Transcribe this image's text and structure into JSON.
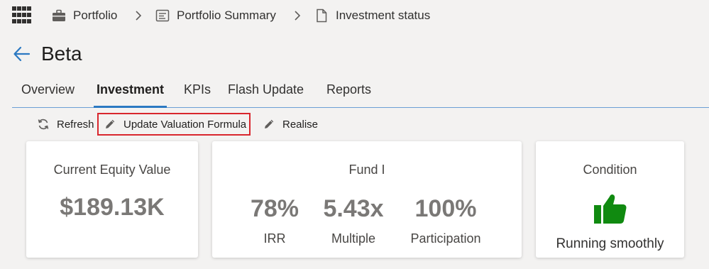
{
  "breadcrumb": {
    "items": [
      {
        "label": "Portfolio",
        "icon": "briefcase-icon"
      },
      {
        "label": "Portfolio Summary",
        "icon": "summary-document-icon"
      },
      {
        "label": "Investment status",
        "icon": "page-icon"
      }
    ]
  },
  "page": {
    "title": "Beta"
  },
  "tabs": [
    {
      "label": "Overview",
      "active": false
    },
    {
      "label": "Investment",
      "active": true
    },
    {
      "label": "KPIs",
      "active": false
    },
    {
      "label": "Flash Update",
      "active": false
    },
    {
      "label": "Reports",
      "active": false
    }
  ],
  "commands": {
    "refresh": "Refresh",
    "update_valuation": "Update Valuation Formula",
    "realise": "Realise"
  },
  "cards": {
    "equity": {
      "title": "Current Equity Value",
      "value": "$189.13K"
    },
    "fund": {
      "title": "Fund I",
      "metrics": [
        {
          "value": "78%",
          "label": "IRR"
        },
        {
          "value": "5.43x",
          "label": "Multiple"
        },
        {
          "value": "100%",
          "label": "Participation"
        }
      ]
    },
    "condition": {
      "title": "Condition",
      "status": "Running smoothly",
      "icon": "thumbs-up-icon"
    }
  },
  "colors": {
    "accent": "#2b79c2",
    "highlight_border": "#d9272e",
    "thumb_green": "#108a10",
    "background": "#f3f2f1"
  }
}
